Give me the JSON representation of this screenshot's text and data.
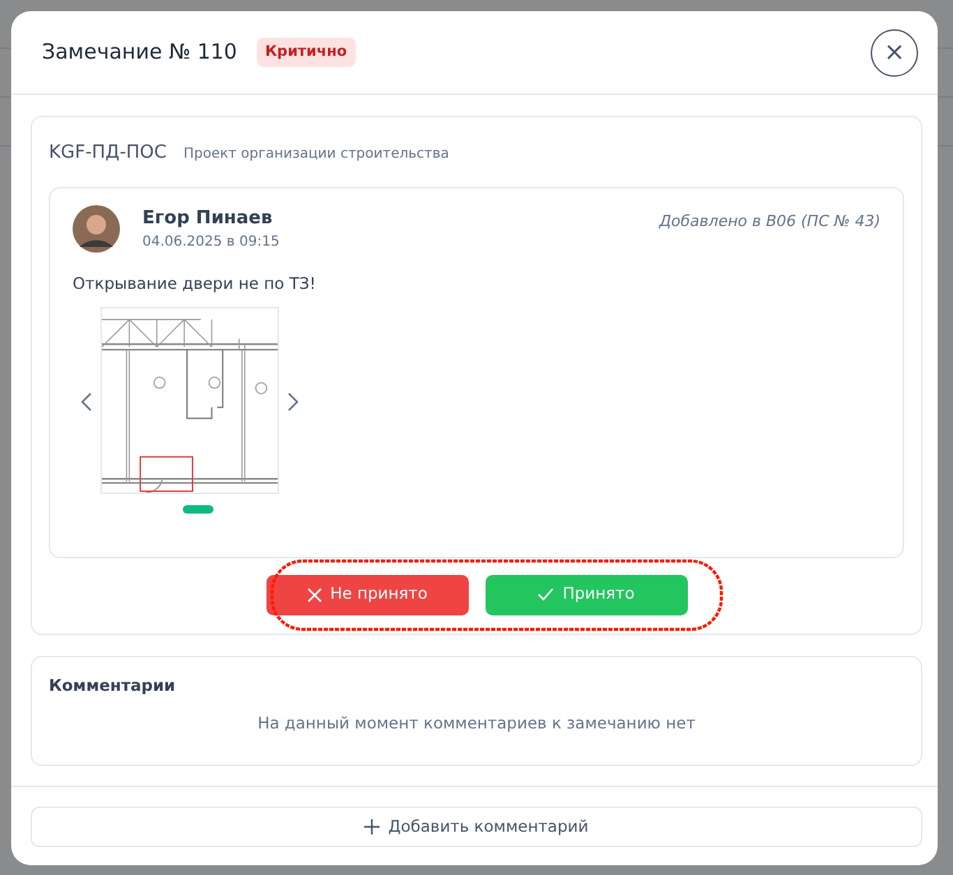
{
  "modal": {
    "title": "Замечание № 110",
    "severity": {
      "label": "Критично",
      "kind": "critical"
    },
    "close": "×"
  },
  "document": {
    "code": "KGF-ПД-ПОС",
    "name": "Проект организации строительства"
  },
  "remark": {
    "author": "Егор Пинаев",
    "date": "04.06.2025 в 09:15",
    "added": "Добавлено в В06 (ПС № 43)",
    "text": "Открывание двери не по ТЗ!",
    "attachments": [
      {
        "kind": "floor-plan",
        "selected": true
      }
    ]
  },
  "actions": [
    {
      "label": "Не принято",
      "kind": "reject"
    },
    {
      "label": "Принято",
      "kind": "accept"
    }
  ],
  "comments": {
    "title": "Комментарии",
    "empty": "На данный момент комментариев к замечанию нет"
  },
  "add_comment": "Добавить комментарий"
}
